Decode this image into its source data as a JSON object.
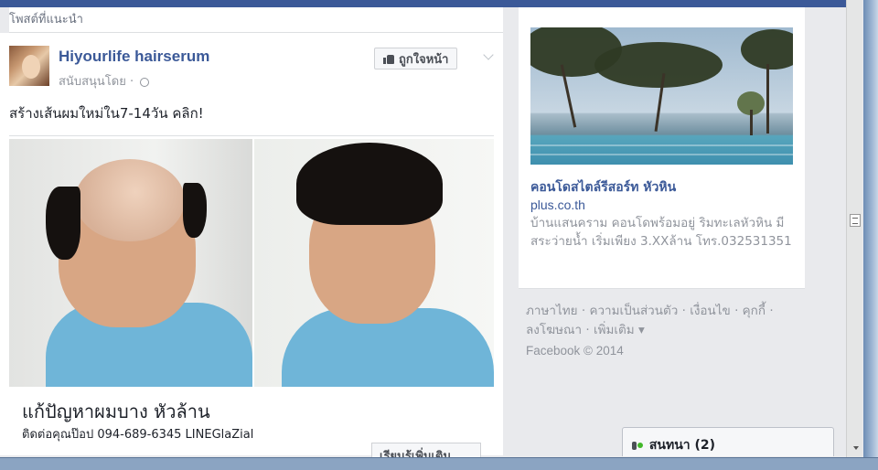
{
  "feed": {
    "section_label": "โพสต์ที่แนะนำ",
    "post": {
      "page_name": "Hiyourlife hairserum",
      "sponsored_label": "สนับสนุนโดย ·",
      "like_label": "ถูกใจหน้า",
      "text": "สร้างเส้นผมใหม่ใน7-14วัน คลิก!",
      "ad_title": "แก้ปัญหาผมบาง หัวล้าน",
      "ad_description": "ติดต่อคุณป๊อป 094-689-6345 LINEGlaZial",
      "learn_more_label": "เรียนรู้เพิ่มเติม"
    }
  },
  "sidebar": {
    "ad": {
      "title": "คอนโดสไตล์รีสอร์ท หัวหิน",
      "domain": "plus.co.th",
      "body": "บ้านแสนคราม คอนโดพร้อมอยู่ ริมทะเลหัวหิน มีสระว่ายน้ำ เริ่มเพียง 3.XXล้าน โทร.032531351"
    },
    "footer_links": [
      "ภาษาไทย",
      "ความเป็นส่วนตัว",
      "เงื่อนไข",
      "คุกกี้",
      "ลงโฆษณา",
      "เพิ่มเติม ▾"
    ],
    "copyright": "Facebook © 2014"
  },
  "chat": {
    "label": "สนทนา (2)"
  },
  "icons": {
    "like": "thumbs-up-icon",
    "globe": "globe-icon",
    "chevron": "chevron-down-icon",
    "chat": "chat-online-icon"
  },
  "colors": {
    "brand": "#3b5998",
    "muted": "#90949c",
    "background": "#e9eaed"
  }
}
